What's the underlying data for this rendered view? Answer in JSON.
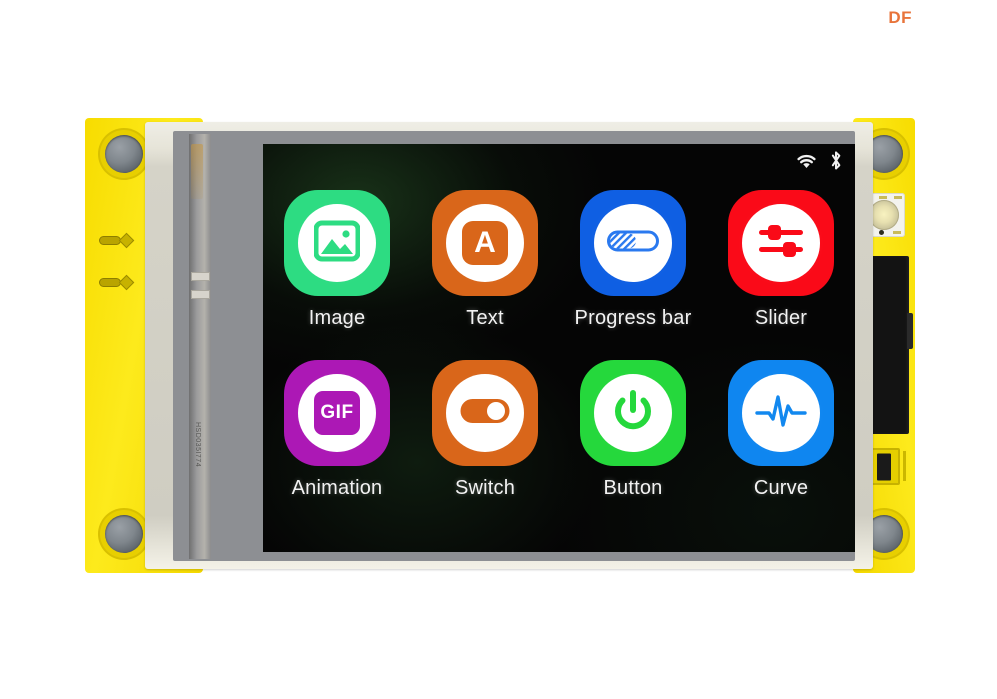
{
  "watermark": {
    "text": "DF",
    "color": "#e8743b"
  },
  "device": {
    "name": "lcd-touch-display-module",
    "pcb_color": "#fbe100",
    "bezel_color": "#d5d3c8",
    "flex_cable_marking": "HSD035I774"
  },
  "screen": {
    "background_color": "#050505",
    "statusbar": {
      "icons": [
        {
          "name": "wifi-icon",
          "label": "WiFi",
          "color": "#f0f0f0"
        },
        {
          "name": "bluetooth-icon",
          "label": "Bluetooth",
          "color": "#f0f0f0"
        }
      ]
    },
    "apps": [
      {
        "id": "image",
        "label": "Image",
        "icon": "picture-icon",
        "tile_color": "#2ddc82",
        "glyph_color": "#2ddc82"
      },
      {
        "id": "text",
        "label": "Text",
        "icon": "letter-a-icon",
        "tile_color": "#d9661a",
        "glyph_color": "#d9661a"
      },
      {
        "id": "progress-bar",
        "label": "Progress bar",
        "icon": "progress-icon",
        "tile_color": "#0f5fe3",
        "glyph_color": "#2a79ef"
      },
      {
        "id": "slider",
        "label": "Slider",
        "icon": "sliders-icon",
        "tile_color": "#fa0a18",
        "glyph_color": "#fa0a18"
      },
      {
        "id": "animation",
        "label": "Animation",
        "icon": "gif-icon",
        "tile_color": "#ac18b5",
        "glyph_color": "#ac18b5"
      },
      {
        "id": "switch",
        "label": "Switch",
        "icon": "toggle-on-icon",
        "tile_color": "#d9661a",
        "glyph_color": "#d9661a"
      },
      {
        "id": "button",
        "label": "Button",
        "icon": "power-icon",
        "tile_color": "#25d83c",
        "glyph_color": "#25d83c"
      },
      {
        "id": "curve",
        "label": "Curve",
        "icon": "waveform-icon",
        "tile_color": "#0f86f0",
        "glyph_color": "#1288ef"
      }
    ]
  }
}
